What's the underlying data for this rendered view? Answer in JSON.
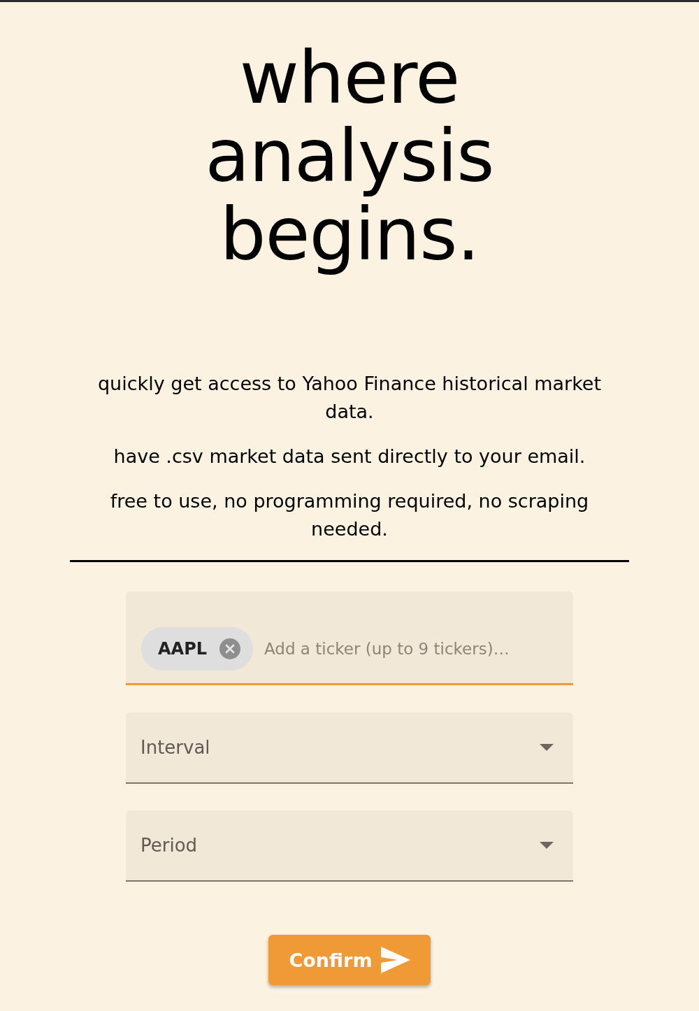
{
  "heading": "where analysis begins.",
  "taglines": [
    "quickly get access to Yahoo Finance historical market data.",
    "have .csv market data sent directly to your email.",
    "free to use, no programming required, no scraping needed."
  ],
  "ticker_field": {
    "focused": true,
    "chips": [
      {
        "label": "AAPL"
      }
    ],
    "placeholder": "Add a ticker (up to 9 tickers)…"
  },
  "selects": [
    {
      "label": "Interval"
    },
    {
      "label": "Period"
    }
  ],
  "confirm_button": {
    "label": "Confirm"
  }
}
